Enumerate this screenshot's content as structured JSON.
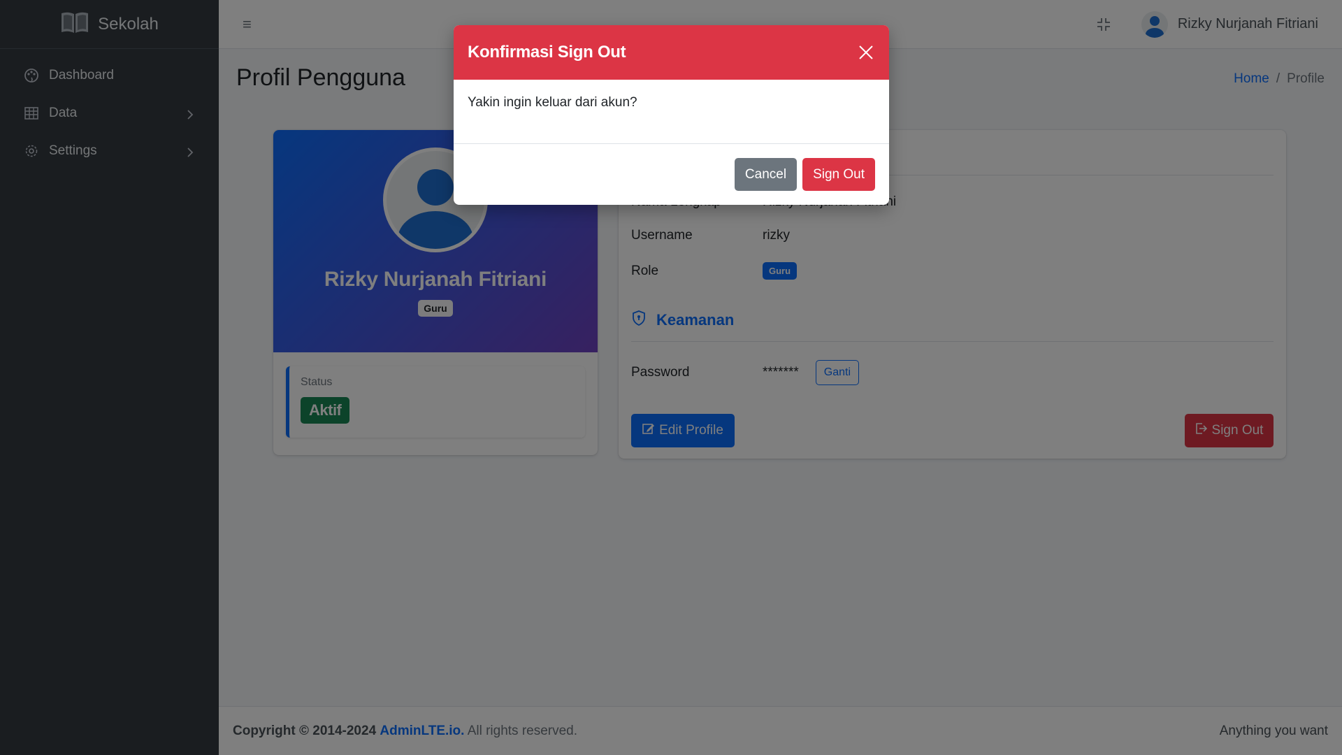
{
  "sidebar": {
    "brand": "Sekolah",
    "brand_icon": "book-open-icon",
    "items": [
      {
        "label": "Dashboard",
        "icon": "palette-icon"
      },
      {
        "label": "Data",
        "icon": "table-icon"
      },
      {
        "label": "Settings",
        "icon": "gear-icon"
      }
    ]
  },
  "header": {
    "menu_icon": "≡",
    "user_name": "Rizky Nurjanah Fitriani"
  },
  "page": {
    "title": "Profil Pengguna",
    "breadcrumb": {
      "home": "Home",
      "separator": "/",
      "current": "Profile"
    }
  },
  "profile": {
    "name": "Rizky Nurjanah Fitriani",
    "role_badge": "Guru",
    "status_label": "Status",
    "status_value": "Aktif"
  },
  "info": {
    "rows": [
      {
        "key": "Nama Lengkap",
        "value": "Rizky Nurjanah Fitriani"
      },
      {
        "key": "Username",
        "value": "rizky"
      },
      {
        "key": "Role",
        "value": "Guru"
      }
    ],
    "security_title": "Keamanan",
    "password_key": "Password",
    "password_value": "*******",
    "change_label": "Ganti",
    "edit_label": "Edit Profile",
    "signout_label": "Sign Out"
  },
  "footer": {
    "copyright": "Copyright © 2014-2024",
    "link": "AdminLTE.io.",
    "rights": "All rights reserved.",
    "right_text": "Anything you want"
  },
  "modal": {
    "title": "Konfirmasi Sign Out",
    "message": "Yakin ingin keluar dari akun?",
    "cancel_label": "Cancel",
    "confirm_label": "Sign Out"
  },
  "colors": {
    "primary": "#0d6efd",
    "danger": "#dc3545",
    "success": "#198754",
    "sidebar": "#343a40"
  }
}
